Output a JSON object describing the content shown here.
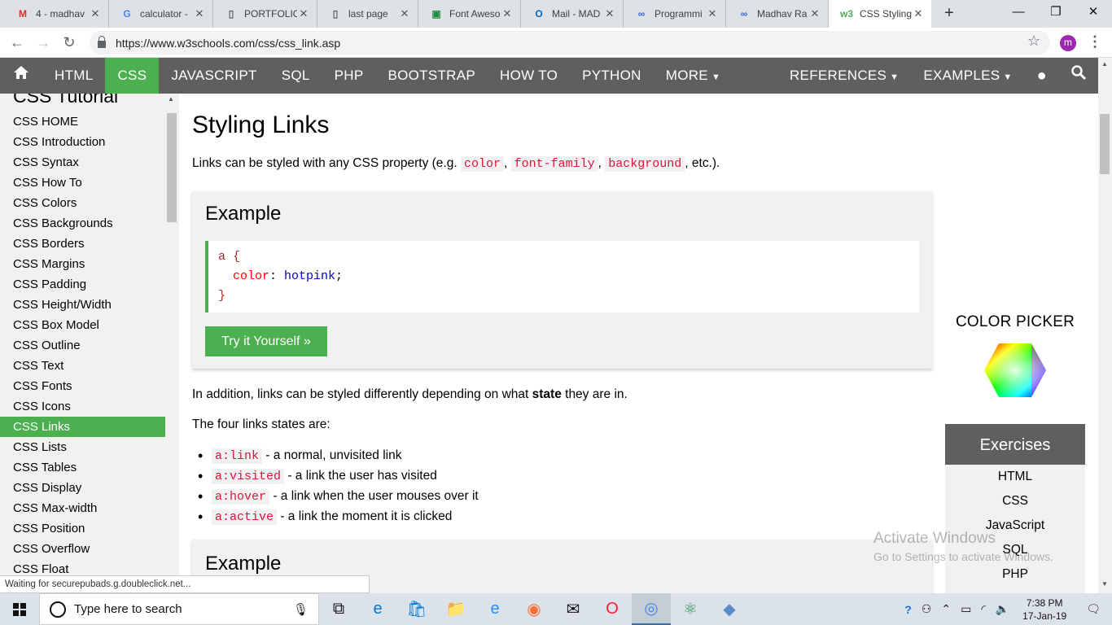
{
  "browser": {
    "tabs": [
      {
        "title": "4 - madhav",
        "icon": "gmail-icon",
        "icon_glyph": "M",
        "icon_color": "#d93025"
      },
      {
        "title": "calculator -",
        "icon": "google-icon",
        "icon_glyph": "G",
        "icon_color": "#4285f4"
      },
      {
        "title": "PORTFOLIO",
        "icon": "page-icon",
        "icon_glyph": "▯",
        "icon_color": "#5f6368"
      },
      {
        "title": "last page",
        "icon": "page-icon",
        "icon_glyph": "▯",
        "icon_color": "#5f6368"
      },
      {
        "title": "Font Aweso",
        "icon": "sheet-icon",
        "icon_glyph": "▣",
        "icon_color": "#1e8e3e"
      },
      {
        "title": "Mail - MAD",
        "icon": "outlook-icon",
        "icon_glyph": "O",
        "icon_color": "#0a64b8"
      },
      {
        "title": "Programmi",
        "icon": "link-icon",
        "icon_glyph": "∞",
        "icon_color": "#3367d6"
      },
      {
        "title": "Madhav Ra",
        "icon": "link-icon",
        "icon_glyph": "∞",
        "icon_color": "#3367d6"
      },
      {
        "title": "CSS Styling",
        "icon": "w3schools-icon",
        "icon_glyph": "w3",
        "icon_color": "#4CAF50"
      }
    ],
    "url": "https://www.w3schools.com/css/css_link.asp",
    "profile_initial": "m",
    "status_text": "Waiting for securepubads.g.doubleclick.net..."
  },
  "topnav": {
    "items": [
      "HTML",
      "CSS",
      "JAVASCRIPT",
      "SQL",
      "PHP",
      "BOOTSTRAP",
      "HOW TO",
      "PYTHON",
      "MORE"
    ],
    "right": [
      "REFERENCES",
      "EXAMPLES"
    ],
    "active": "CSS"
  },
  "sidebar": {
    "heading": "CSS Tutorial",
    "links": [
      "CSS HOME",
      "CSS Introduction",
      "CSS Syntax",
      "CSS How To",
      "CSS Colors",
      "CSS Backgrounds",
      "CSS Borders",
      "CSS Margins",
      "CSS Padding",
      "CSS Height/Width",
      "CSS Box Model",
      "CSS Outline",
      "CSS Text",
      "CSS Fonts",
      "CSS Icons",
      "CSS Links",
      "CSS Lists",
      "CSS Tables",
      "CSS Display",
      "CSS Max-width",
      "CSS Position",
      "CSS Overflow",
      "CSS Float"
    ],
    "active": "CSS Links"
  },
  "main": {
    "title": "Styling Links",
    "intro_prefix": "Links can be styled with any CSS property (e.g. ",
    "intro_codes": [
      "color",
      "font-family",
      "background"
    ],
    "intro_suffix": ", etc.).",
    "example": {
      "heading": "Example",
      "code_selector": "a {",
      "code_property": "color",
      "code_value": "hotpink",
      "code_close": "}",
      "button": "Try it Yourself »"
    },
    "state_para_prefix": "In addition, links can be styled differently depending on what ",
    "state_para_bold": "state",
    "state_para_suffix": " they are in.",
    "four_states": "The four links states are:",
    "states": [
      {
        "code": "a:link",
        "desc": " - a normal, unvisited link"
      },
      {
        "code": "a:visited",
        "desc": " - a link the user has visited"
      },
      {
        "code": "a:hover",
        "desc": " - a link when the user mouses over it"
      },
      {
        "code": "a:active",
        "desc": " - a link the moment it is clicked"
      }
    ],
    "example2_heading": "Example"
  },
  "right": {
    "color_picker": "COLOR PICKER",
    "exercises_heading": "Exercises",
    "exercises": [
      "HTML",
      "CSS",
      "JavaScript",
      "SQL",
      "PHP"
    ]
  },
  "watermark": {
    "line1": "Activate Windows",
    "line2": "Go to Settings to activate Windows."
  },
  "taskbar": {
    "search_placeholder": "Type here to search",
    "time": "7:38 PM",
    "date": "17-Jan-19",
    "apps": [
      {
        "name": "task-view-icon",
        "glyph": "⧉",
        "color": "#111"
      },
      {
        "name": "edge-icon",
        "glyph": "e",
        "color": "#0078d7"
      },
      {
        "name": "store-icon",
        "glyph": "🛍",
        "color": "#0078d7"
      },
      {
        "name": "file-explorer-icon",
        "glyph": "📁",
        "color": "#e8b400"
      },
      {
        "name": "ie-icon",
        "glyph": "e",
        "color": "#1e90ff"
      },
      {
        "name": "firefox-icon",
        "glyph": "◉",
        "color": "#ff7139"
      },
      {
        "name": "mail-icon",
        "glyph": "✉",
        "color": "#111"
      },
      {
        "name": "opera-icon",
        "glyph": "O",
        "color": "#ff1b2d"
      },
      {
        "name": "chrome-icon",
        "glyph": "◎",
        "color": "#4285f4"
      },
      {
        "name": "atom-icon",
        "glyph": "⚛",
        "color": "#2e8b57"
      },
      {
        "name": "virtualbox-icon",
        "glyph": "◆",
        "color": "#5a8dc8"
      }
    ]
  },
  "colors": {
    "w3_green": "#4CAF50",
    "nav_gray": "#5f5f5f",
    "code_red": "#dc143c"
  }
}
